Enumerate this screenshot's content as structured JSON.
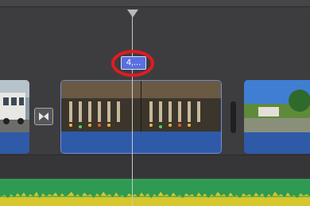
{
  "timeline": {
    "title_badge_label": "4,...",
    "colors": {
      "background": "#3d3d3f",
      "clip_bar": "#2f5aa8",
      "title_badge": "#5a6fe0",
      "highlight_ring": "#e11b22",
      "audio_track": "#2e9a52",
      "audio_wave": "#d6c72e"
    },
    "icons": {
      "transition": "bowtie-transition-icon",
      "playhead": "playhead-marker-icon"
    }
  }
}
